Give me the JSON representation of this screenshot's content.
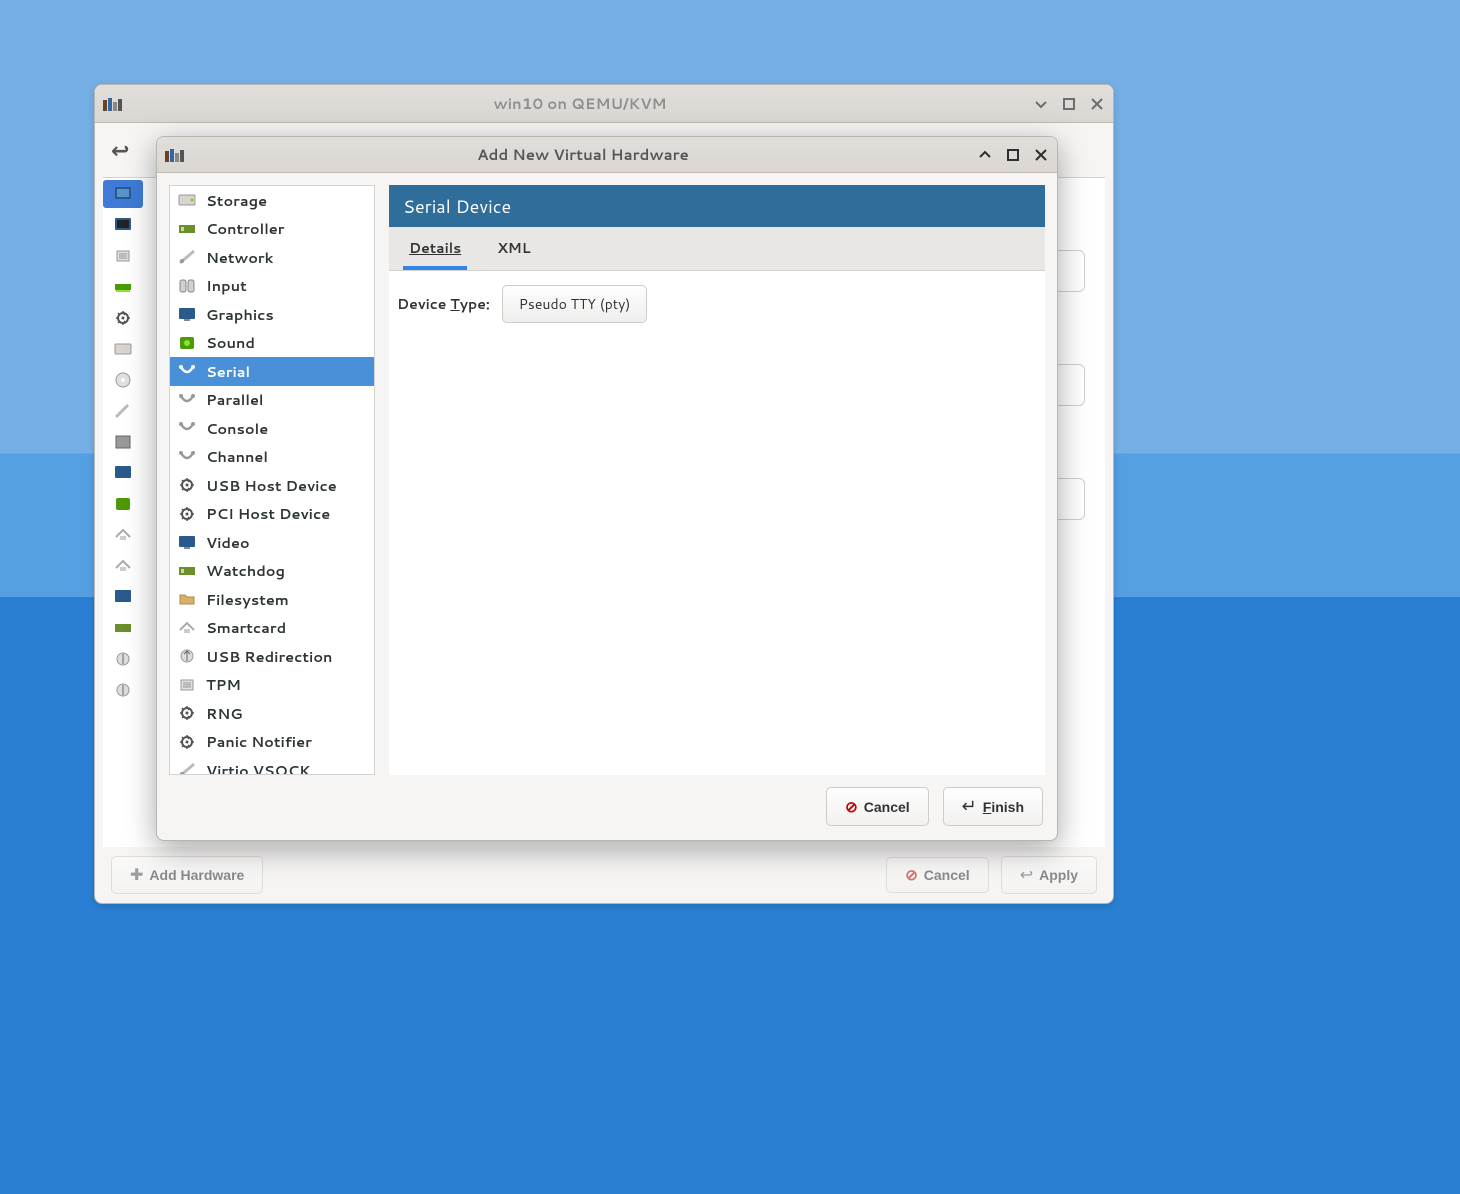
{
  "parent_window": {
    "title": "win10 on QEMU/KVM",
    "add_hardware_label": "Add Hardware",
    "cancel_label": "Cancel",
    "apply_label": "Apply",
    "sidebar_icons": [
      "display-icon",
      "monitor-icon",
      "cpu-icon",
      "memory-icon",
      "gear-icon",
      "disk-icon",
      "cdrom-icon",
      "pen-icon",
      "tablet-icon",
      "display2-icon",
      "sound-green-icon",
      "floppy-icon",
      "floppy2-icon",
      "monitor2-icon",
      "pci-card-icon",
      "usb-icon",
      "usb2-icon"
    ]
  },
  "dialog": {
    "title": "Add New Virtual Hardware",
    "panel_title": "Serial Device",
    "tabs": {
      "details": "Details",
      "xml": "XML",
      "active": "details"
    },
    "device_type_label": "Device Type:",
    "device_type_value": "Pseudo TTY (pty)",
    "cancel_label": "Cancel",
    "finish_label": "Finish",
    "selected_hw": "Serial",
    "hw_items": [
      {
        "label": "Storage",
        "icon": "storage-icon"
      },
      {
        "label": "Controller",
        "icon": "controller-icon"
      },
      {
        "label": "Network",
        "icon": "network-icon"
      },
      {
        "label": "Input",
        "icon": "input-icon"
      },
      {
        "label": "Graphics",
        "icon": "graphics-icon"
      },
      {
        "label": "Sound",
        "icon": "sound-icon"
      },
      {
        "label": "Serial",
        "icon": "serial-icon"
      },
      {
        "label": "Parallel",
        "icon": "parallel-icon"
      },
      {
        "label": "Console",
        "icon": "console-icon"
      },
      {
        "label": "Channel",
        "icon": "channel-icon"
      },
      {
        "label": "USB Host Device",
        "icon": "gear-icon"
      },
      {
        "label": "PCI Host Device",
        "icon": "gear-icon"
      },
      {
        "label": "Video",
        "icon": "video-icon"
      },
      {
        "label": "Watchdog",
        "icon": "watchdog-icon"
      },
      {
        "label": "Filesystem",
        "icon": "folder-icon"
      },
      {
        "label": "Smartcard",
        "icon": "smartcard-icon"
      },
      {
        "label": "USB Redirection",
        "icon": "usb-redir-icon"
      },
      {
        "label": "TPM",
        "icon": "tpm-icon"
      },
      {
        "label": "RNG",
        "icon": "gear-icon"
      },
      {
        "label": "Panic Notifier",
        "icon": "gear-icon"
      },
      {
        "label": "Virtio VSOCK",
        "icon": "vsock-icon"
      }
    ]
  }
}
